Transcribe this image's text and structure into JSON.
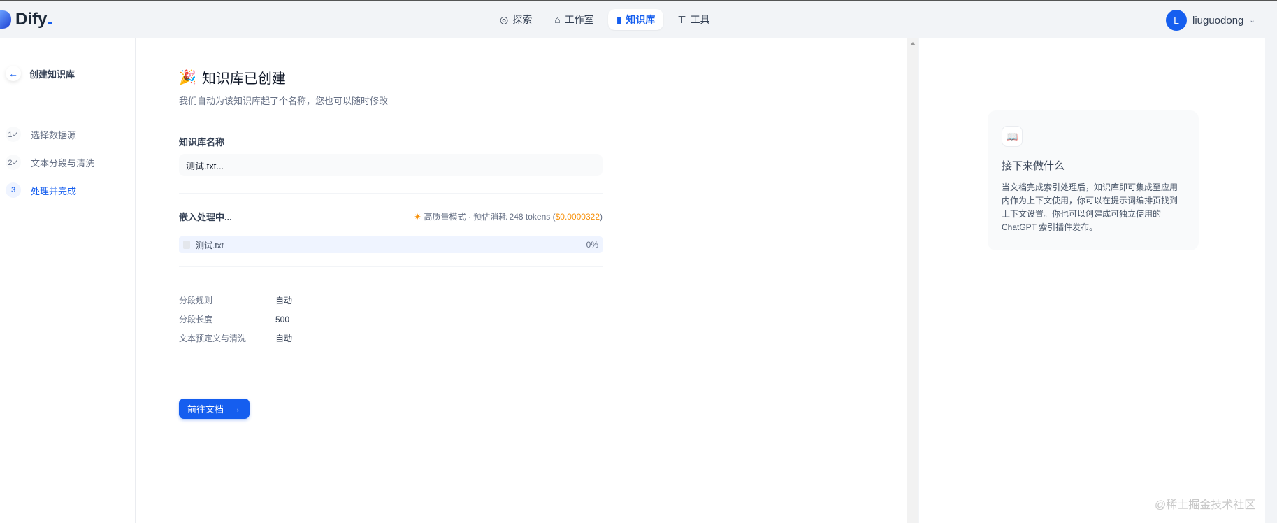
{
  "app": {
    "name": "Dify"
  },
  "nav": [
    {
      "label": "探索",
      "icon": "compass-icon"
    },
    {
      "label": "工作室",
      "icon": "robot-icon"
    },
    {
      "label": "知识库",
      "icon": "book-icon",
      "active": true
    },
    {
      "label": "工具",
      "icon": "hammer-icon"
    }
  ],
  "user": {
    "initial": "L",
    "name": "liuguodong"
  },
  "sidebar": {
    "back_label": "创建知识库",
    "steps": [
      {
        "num": "1✓",
        "label": "选择数据源"
      },
      {
        "num": "2✓",
        "label": "文本分段与清洗"
      },
      {
        "num": "3",
        "label": "处理并完成",
        "active": true
      }
    ]
  },
  "main": {
    "title": "知识库已创建",
    "title_emoji": "🎉",
    "subtitle": "我们自动为该知识库起了个名称，您也可以随时修改",
    "name_label": "知识库名称",
    "name_value": "测试.txt...",
    "embedding": {
      "title": "嵌入处理中...",
      "mode": "高质量模式 · 预估消耗 248 tokens (",
      "cost": "$0.0000322",
      "close": ")"
    },
    "file": {
      "name": "测试.txt",
      "progress_label": "0%",
      "progress": 0
    },
    "rules": [
      {
        "key": "分段规则",
        "value": "自动"
      },
      {
        "key": "分段长度",
        "value": "500"
      },
      {
        "key": "文本预定义与清洗",
        "value": "自动"
      }
    ],
    "go_button": "前往文档"
  },
  "panel": {
    "title": "接下来做什么",
    "text": "当文档完成索引处理后，知识库即可集成至应用内作为上下文使用，你可以在提示词编排页找到上下文设置。你也可以创建成可独立使用的 ChatGPT 索引插件发布。"
  },
  "watermark": "@稀土掘金技术社区"
}
